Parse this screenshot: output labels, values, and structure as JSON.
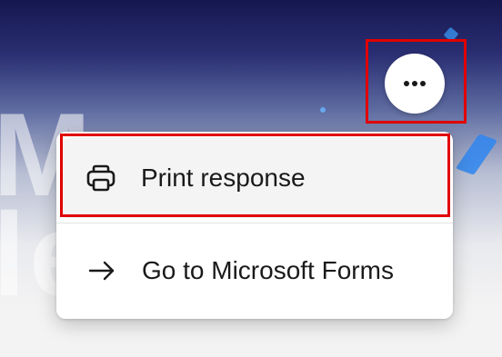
{
  "more_button": {
    "icon": "more-horizontal-icon"
  },
  "menu": {
    "items": [
      {
        "label": "Print response",
        "icon": "printer-icon"
      },
      {
        "label": "Go to Microsoft Forms",
        "icon": "arrow-right-icon"
      }
    ]
  },
  "colors": {
    "highlight_outline": "#e00000",
    "banner_dark": "#15174f",
    "menu_bg": "#ffffff",
    "hover_bg": "#f4f4f4"
  }
}
